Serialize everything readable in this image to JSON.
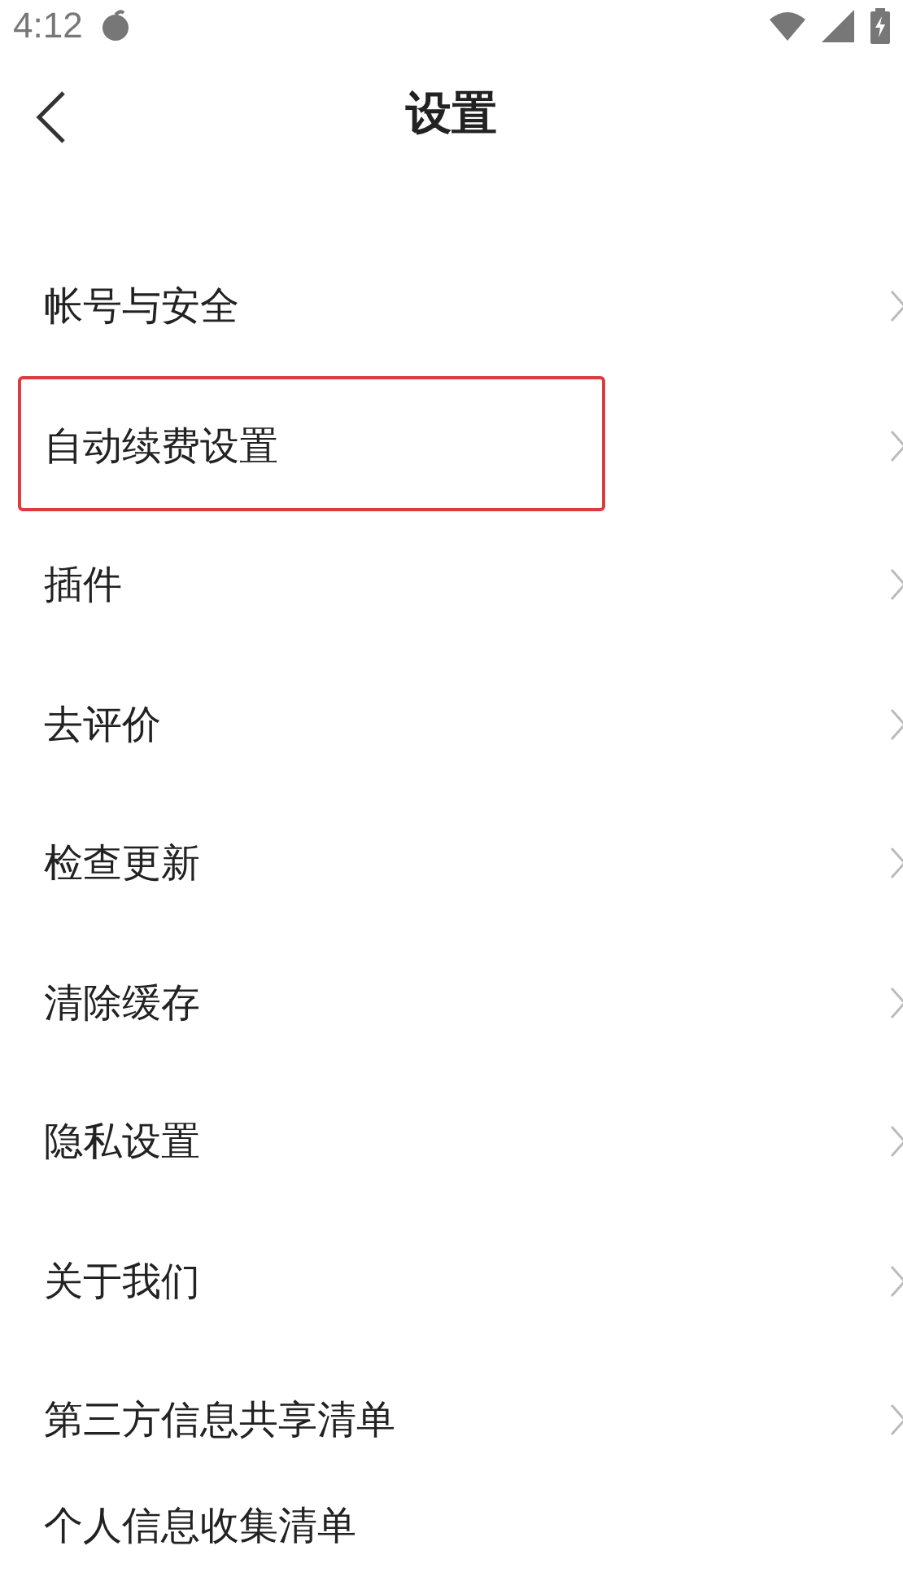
{
  "status_bar": {
    "time": "4:12"
  },
  "header": {
    "title": "设置"
  },
  "items": [
    {
      "label": "帐号与安全",
      "highlighted": false
    },
    {
      "label": "自动续费设置",
      "highlighted": true
    },
    {
      "label": "插件",
      "highlighted": false
    },
    {
      "label": "去评价",
      "highlighted": false
    },
    {
      "label": "检查更新",
      "highlighted": false
    },
    {
      "label": "清除缓存",
      "highlighted": false
    },
    {
      "label": "隐私设置",
      "highlighted": false
    },
    {
      "label": "关于我们",
      "highlighted": false
    },
    {
      "label": "第三方信息共享清单",
      "highlighted": false
    },
    {
      "label": "个人信息收集清单",
      "highlighted": false
    }
  ]
}
